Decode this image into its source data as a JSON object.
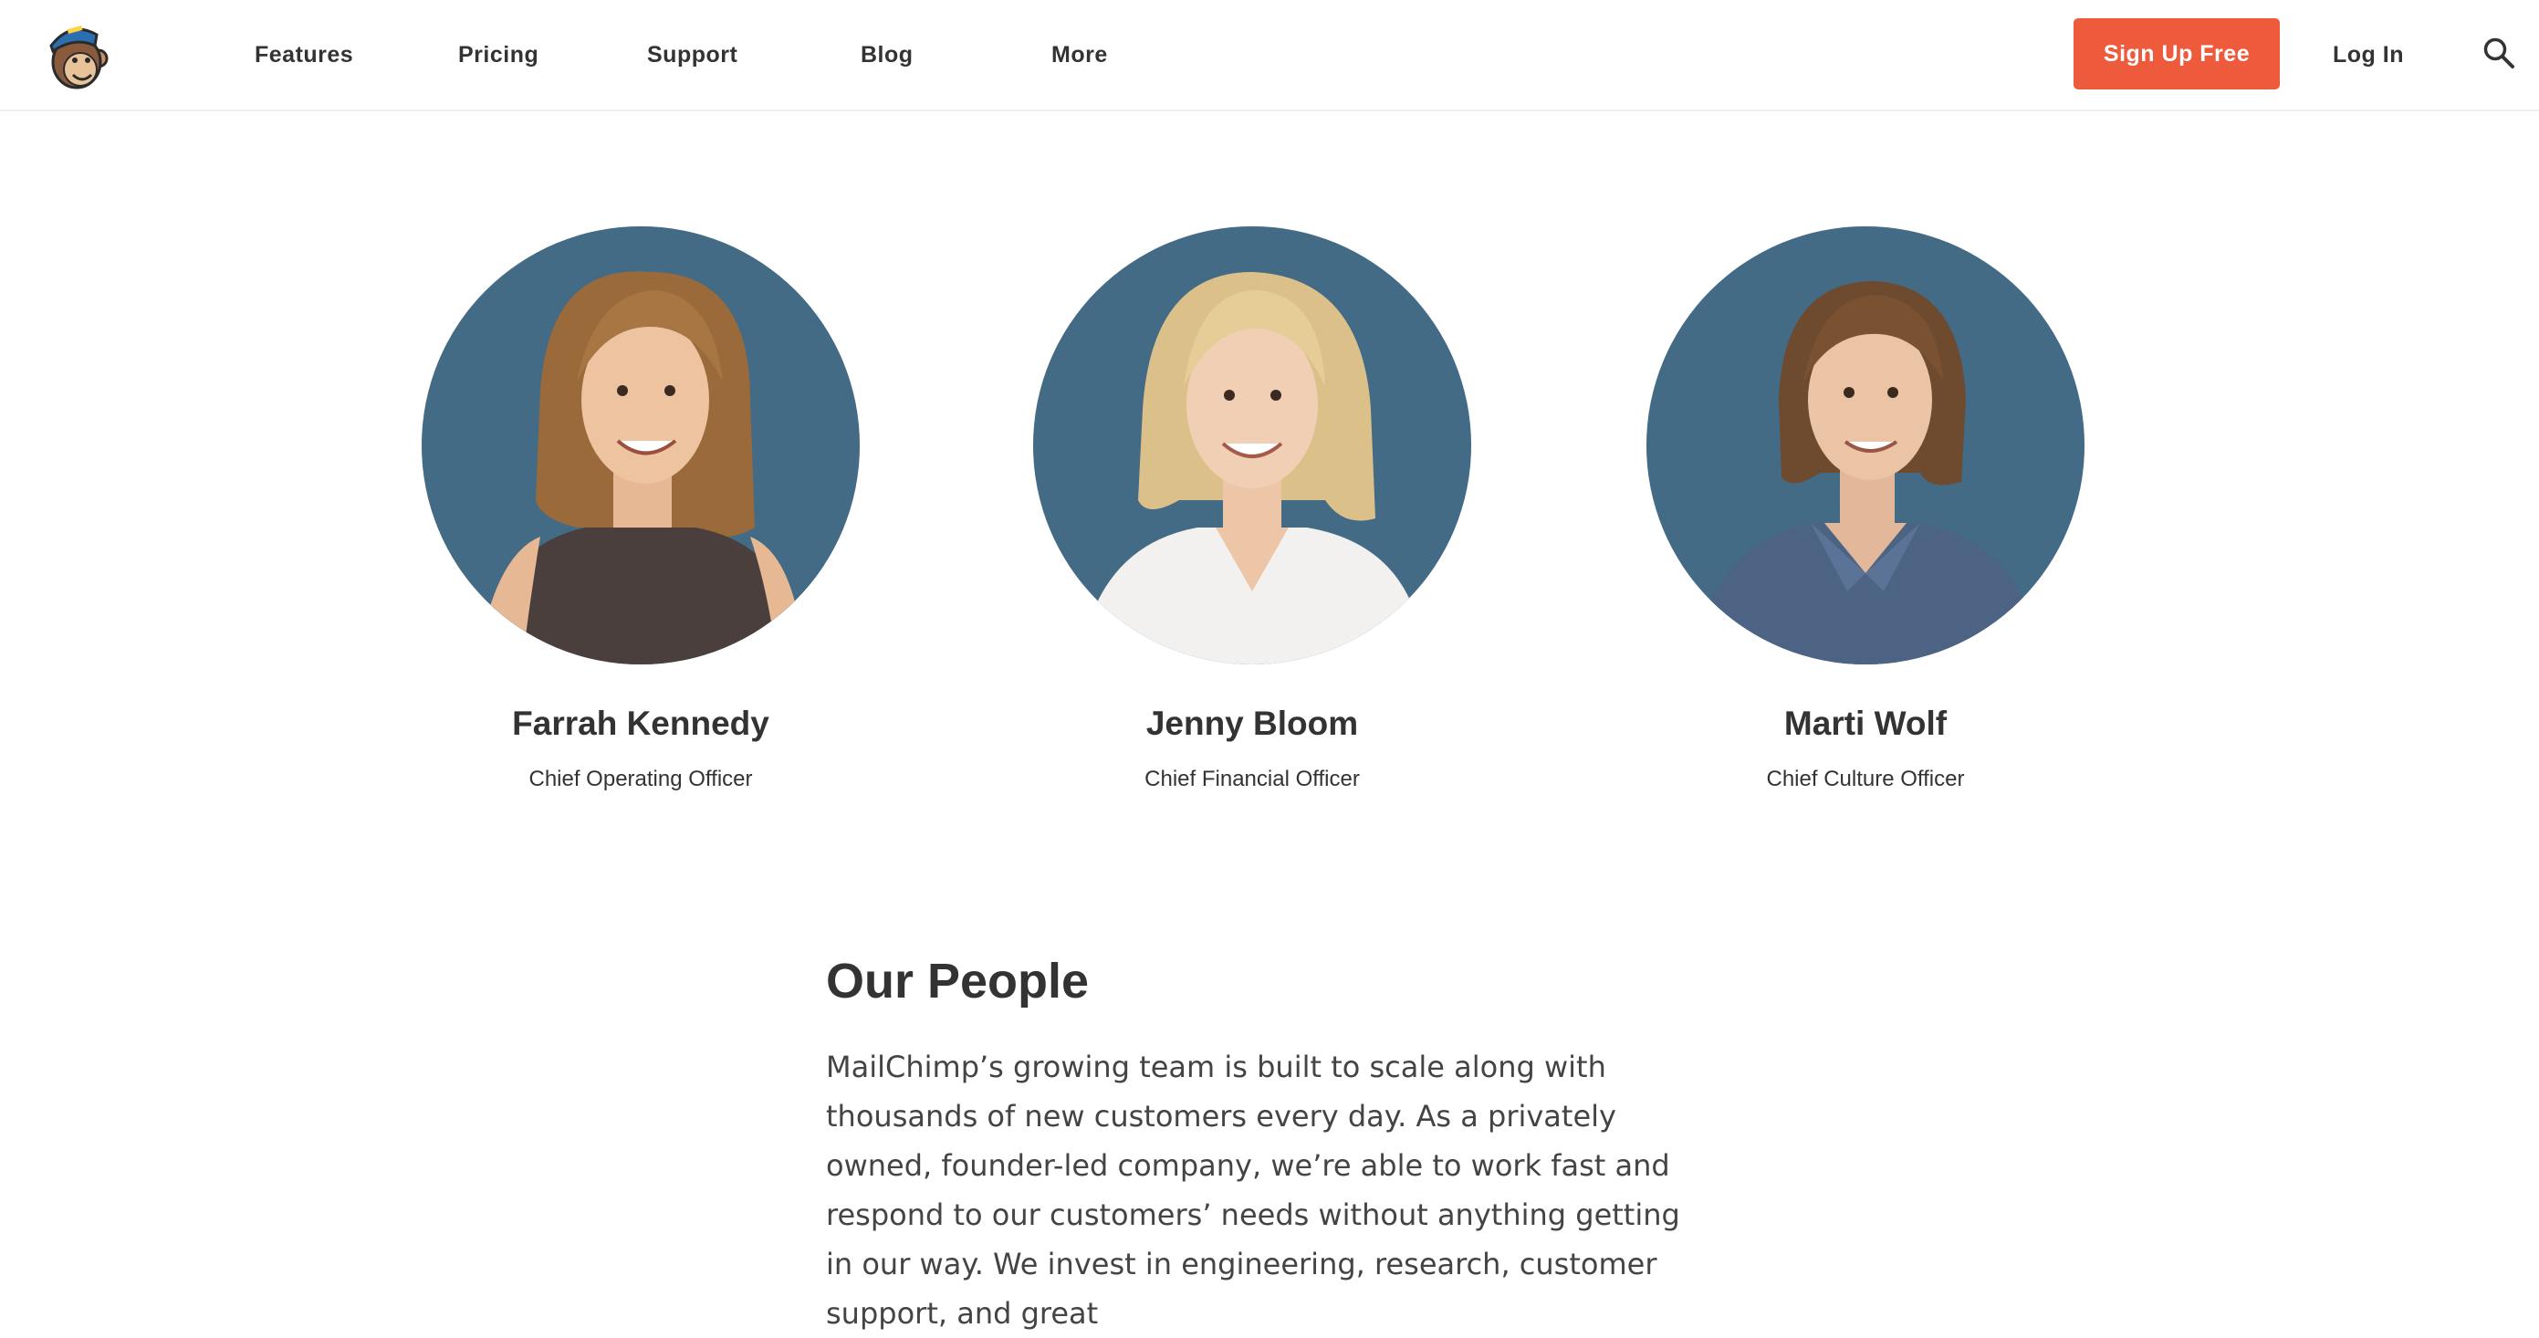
{
  "header": {
    "logo_name": "mailchimp-monkey-logo",
    "nav": [
      "Features",
      "Pricing",
      "Support",
      "Blog",
      "More"
    ],
    "signup_label": "Sign Up Free",
    "login_label": "Log In",
    "search_icon": "search-icon"
  },
  "leaders": [
    {
      "name": "Farrah Kennedy",
      "title": "Chief Operating Officer"
    },
    {
      "name": "Jenny Bloom",
      "title": "Chief Financial Officer"
    },
    {
      "name": "Marti Wolf",
      "title": "Chief Culture Officer"
    }
  ],
  "people": {
    "heading": "Our People",
    "body": "MailChimp’s growing team is built to scale along with thousands of new customers every day. As a privately owned, founder-led company, we’re able to work fast and respond to our customers’ needs without anything getting in our way. We invest in engineering, research, customer support, and great"
  },
  "colors": {
    "accent": "#ee5a3c",
    "text": "#333333",
    "portrait_background": "#3f6680"
  }
}
